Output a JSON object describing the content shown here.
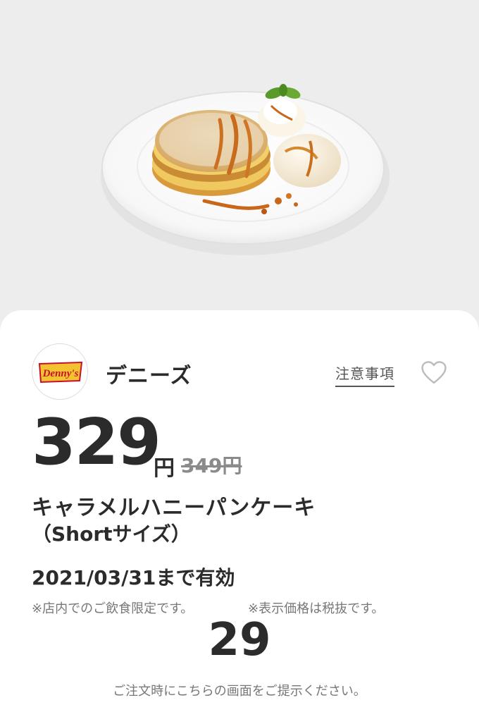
{
  "brand": {
    "name": "デニーズ",
    "logo_text": "Denny's",
    "logo_color": "#f2c230",
    "logo_text_color": "#c8102e"
  },
  "links": {
    "notes": "注意事項"
  },
  "icons": {
    "favorite": "heart-outline-icon"
  },
  "offer": {
    "price": "329",
    "yen": "円",
    "original_price": "349円",
    "title_line1": "キャラメルハニーパンケーキ",
    "title_line2": "（Shortサイズ）",
    "valid_until": "2021/03/31まで有効",
    "note_dine_in": "※店内でのご飲食限定です。",
    "note_tax": "※表示価格は税抜です。",
    "code": "29",
    "instruction": "ご注文時にこちらの画面をご提示ください。"
  },
  "colors": {
    "background": "#ededed",
    "card": "#ffffff",
    "text": "#2b2b2b",
    "muted": "#777777",
    "strike": "#8a8a8a"
  }
}
